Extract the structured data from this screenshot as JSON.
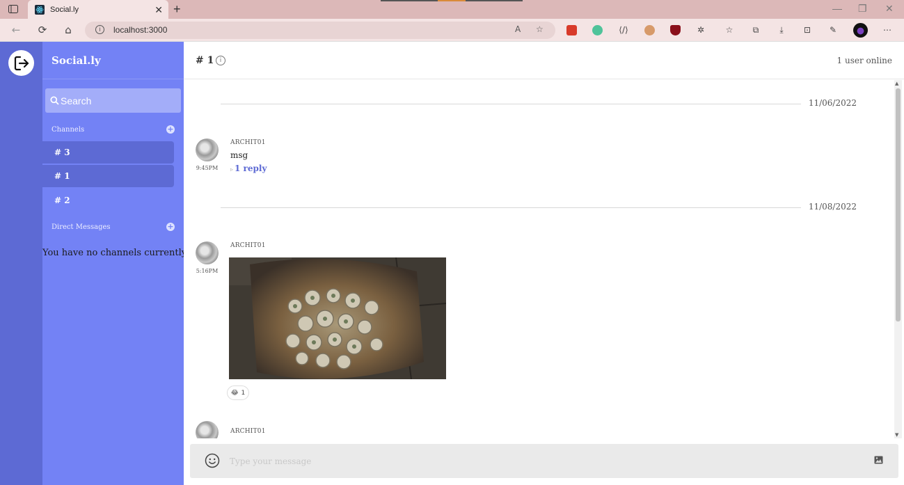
{
  "browser": {
    "tab_title": "Social.ly",
    "url": "localhost:3000",
    "close_glyph": "✕",
    "newtab_glyph": "+",
    "win_controls": [
      "—",
      "❐",
      "✕"
    ],
    "nav": [
      "←",
      "⟳",
      "⌂"
    ],
    "extension_icons": [
      "extension-red-icon",
      "extension-green-icon",
      "code-icon",
      "avatar-ext-icon",
      "shield-ext-icon",
      "puzzle-icon",
      "favorites-icon",
      "collections-icon",
      "download-icon",
      "screenshot-icon",
      "copilot-icon",
      "more-icon"
    ]
  },
  "app": {
    "brand": "Social.ly",
    "search_placeholder": "Search",
    "channels_title": "Channels",
    "channels": [
      {
        "label": "# 3"
      },
      {
        "label": "# 1"
      },
      {
        "label": "# 2"
      }
    ],
    "dm_title": "Direct Messages",
    "dm_empty": "You have no channels currently",
    "header": {
      "channel": "# 1",
      "online": "1 user online"
    },
    "messages": [
      {
        "date": "11/06/2022",
        "author": "ARCHIT01",
        "time": "9:45PM",
        "text": "msg",
        "replies": "1 reply"
      },
      {
        "date": "11/08/2022",
        "author": "ARCHIT01",
        "time": "5:16PM",
        "reaction_emoji": "😂",
        "reaction_count": "1"
      },
      {
        "author": "ARCHIT01"
      }
    ],
    "composer_placeholder": "Type your message"
  },
  "colors": {
    "rail": "#5d6ad4",
    "sidebar": "#7382f5",
    "accent": "#5d6ad4"
  }
}
